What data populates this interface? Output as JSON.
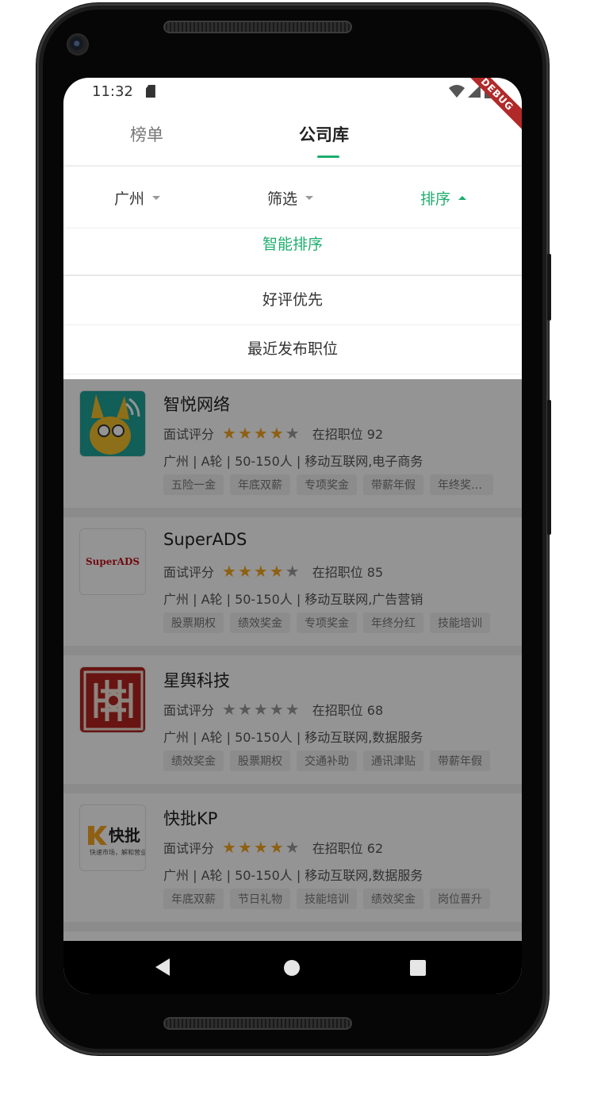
{
  "status": {
    "time": "11:32"
  },
  "debug_label": "DEBUG",
  "tabs": [
    {
      "label": "榜单"
    },
    {
      "label": "公司库"
    }
  ],
  "filters": [
    {
      "label": "广州"
    },
    {
      "label": "筛选"
    },
    {
      "label": "排序"
    }
  ],
  "sort_options": [
    {
      "label": "智能排序",
      "active": true
    },
    {
      "label": "好评优先",
      "active": false
    },
    {
      "label": "最近发布职位",
      "active": false
    }
  ],
  "companies": [
    {
      "name": "智悦网络",
      "rating_label": "面试评分",
      "stars": 4,
      "jobs": "在招职位 92",
      "info": "广州 | A轮 | 50-150人 | 移动互联网,电子商务",
      "tags": [
        "五险一金",
        "年底双薪",
        "专项奖金",
        "带薪年假",
        "年终奖丰..."
      ]
    },
    {
      "name": "SuperADS",
      "rating_label": "面试评分",
      "stars": 4,
      "jobs": "在招职位 85",
      "info": "广州 | A轮 | 50-150人 | 移动互联网,广告营销",
      "tags": [
        "股票期权",
        "绩效奖金",
        "专项奖金",
        "年终分红",
        "技能培训"
      ],
      "logo_text": "SuperADS"
    },
    {
      "name": "星舆科技",
      "rating_label": "面试评分",
      "stars": 0,
      "jobs": "在招职位 68",
      "info": "广州 | A轮 | 50-150人 | 移动互联网,数据服务",
      "tags": [
        "绩效奖金",
        "股票期权",
        "交通补助",
        "通讯津贴",
        "带薪年假"
      ]
    },
    {
      "name": "快批KP",
      "rating_label": "面试评分",
      "stars": 4,
      "jobs": "在招职位 62",
      "info": "广州 | A轮 | 50-150人 | 移动互联网,数据服务",
      "tags": [
        "年底双薪",
        "节日礼物",
        "技能培训",
        "绩效奖金",
        "岗位晋升"
      ],
      "logo_text": "快批",
      "logo_sub": "快速市场，解和营业"
    }
  ],
  "colors": {
    "accent": "#1dad6e",
    "star": "#f5a623"
  }
}
